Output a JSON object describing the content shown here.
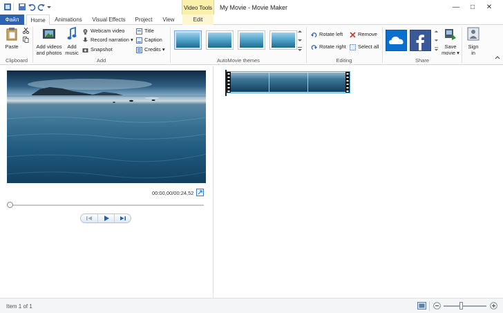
{
  "window": {
    "title": "My Movie - Movie Maker",
    "context_tab_group": "Video Tools",
    "controls": [
      "minimize-icon",
      "maximize-icon",
      "close-icon"
    ]
  },
  "tabs": {
    "file": "Файл",
    "home": "Home",
    "animations": "Animations",
    "visual_effects": "Visual Effects",
    "project": "Project",
    "view": "View",
    "edit": "Edit"
  },
  "ribbon": {
    "clipboard": {
      "label": "Clipboard",
      "paste": "Paste"
    },
    "add": {
      "label": "Add",
      "add_videos_line1": "Add videos",
      "add_videos_line2": "and photos",
      "add_music_line1": "Add",
      "add_music_line2": "music",
      "webcam_video": "Webcam video",
      "record_narration": "Record narration",
      "snapshot": "Snapshot",
      "title": "Title",
      "caption": "Caption",
      "credits": "Credits"
    },
    "themes": {
      "label": "AutoMovie themes",
      "count": 4,
      "selected_index": 0
    },
    "editing": {
      "label": "Editing",
      "rotate_left": "Rotate left",
      "rotate_right": "Rotate right",
      "remove": "Remove",
      "select_all": "Select all"
    },
    "share": {
      "label": "Share",
      "services": [
        "onedrive-icon",
        "facebook-icon"
      ],
      "save_movie_line1": "Save",
      "save_movie_line2": "movie",
      "sign_in_line1": "Sign",
      "sign_in_line2": "in"
    }
  },
  "preview": {
    "time": "00:00,00/00:24,52",
    "position_fraction": 0.0
  },
  "status": {
    "text": "Item 1 of 1",
    "zoom_fraction": 0.4
  },
  "colors": {
    "file_tab": "#2b62b5",
    "context_tab": "#fbf0a9",
    "accent": "#3a7bd5",
    "facebook": "#3b5998",
    "onedrive": "#0b6fcf"
  }
}
